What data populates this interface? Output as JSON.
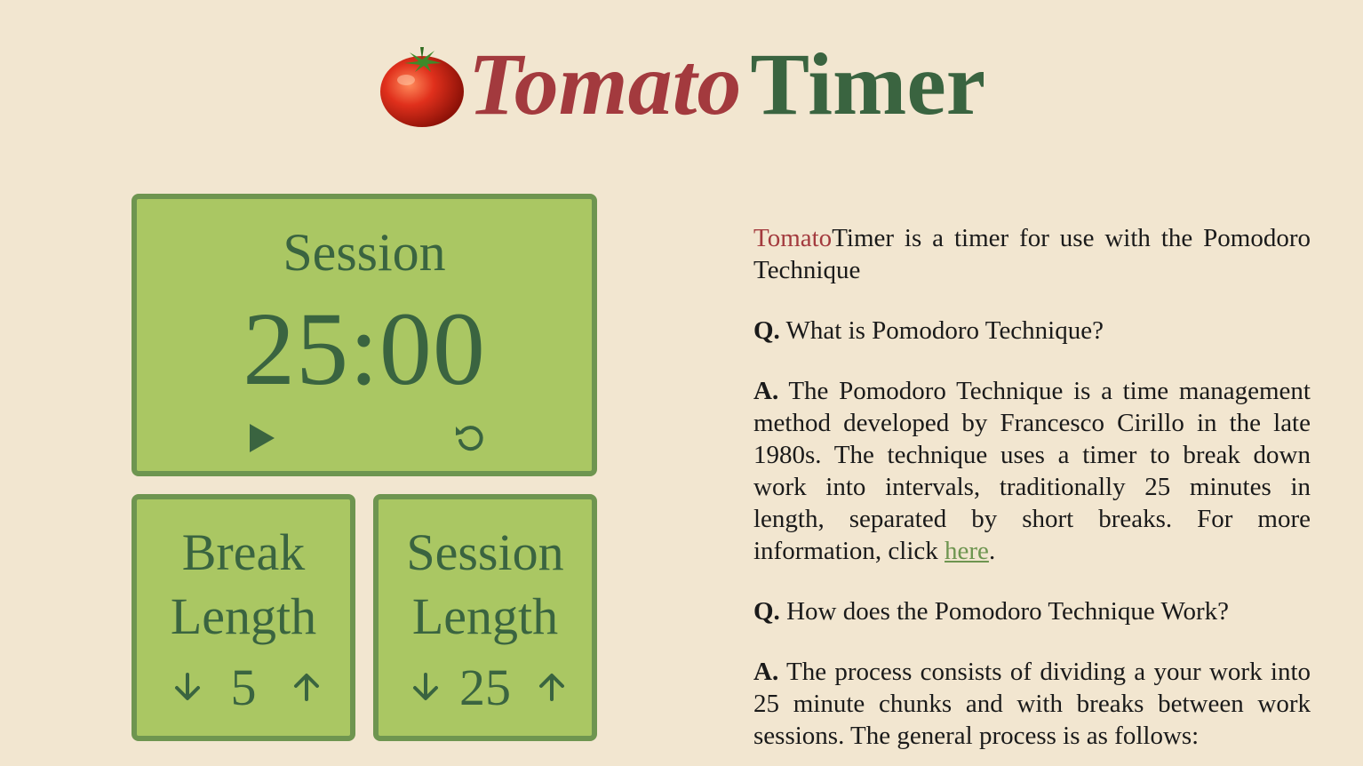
{
  "header": {
    "brand_part1": "Tomato",
    "brand_part2": "Timer"
  },
  "session": {
    "label": "Session",
    "time": "25:00"
  },
  "break_length": {
    "label_line1": "Break",
    "label_line2": "Length",
    "value": "5"
  },
  "session_length": {
    "label_line1": "Session",
    "label_line2": "Length",
    "value": "25"
  },
  "info": {
    "intro_brand": "Tomato",
    "intro_text": "Timer is a timer for use with the Pomodoro Technique",
    "q1_mark": "Q.",
    "q1_text": " What is Pomodoro Technique?",
    "a1_mark": "A.",
    "a1_text": " The Pomodoro Technique is a time management method developed by Francesco Cirillo in the late 1980s. The technique uses a timer to break down work into intervals, traditionally 25 minutes in length, separated by short breaks. For more information, click ",
    "a1_link": "here",
    "a1_end": ".",
    "q2_mark": "Q.",
    "q2_text": " How does the Pomodoro Technique Work?",
    "a2_mark": "A.",
    "a2_text": " The process consists of dividing a your work into 25 minute chunks and with breaks between work sessions. The general process is as follows:"
  },
  "colors": {
    "background": "#f2e6d0",
    "panel": "#aac763",
    "panel_border": "#6e9550",
    "dark_green": "#3a6440",
    "tomato_red": "#a33a3e"
  }
}
